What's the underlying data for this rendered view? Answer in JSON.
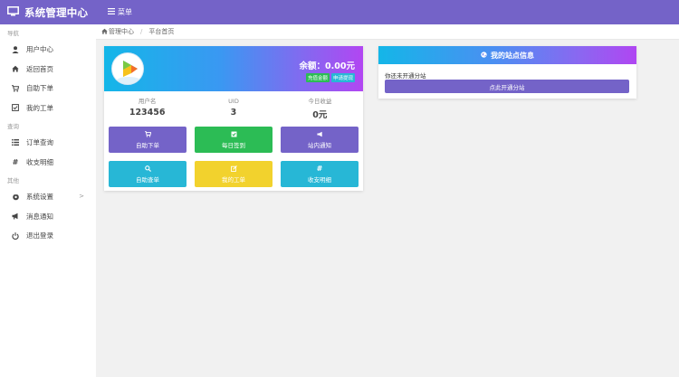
{
  "header": {
    "brand_title": "系统管理中心",
    "menu_label": "菜单"
  },
  "sidebar": {
    "sections": [
      {
        "title": "导航",
        "items": [
          {
            "label": "用户中心",
            "icon": "user-icon"
          },
          {
            "label": "返回首页",
            "icon": "home-icon"
          },
          {
            "label": "自助下单",
            "icon": "cart-icon"
          },
          {
            "label": "我的工单",
            "icon": "checkbox-icon"
          }
        ]
      },
      {
        "title": "查询",
        "items": [
          {
            "label": "订单查询",
            "icon": "list-icon"
          },
          {
            "label": "收支明细",
            "icon": "hash-icon"
          }
        ]
      },
      {
        "title": "其他",
        "items": [
          {
            "label": "系统设置",
            "icon": "settings-icon",
            "arrow": ">"
          },
          {
            "label": "消息通知",
            "icon": "bullhorn-icon"
          },
          {
            "label": "退出登录",
            "icon": "power-icon"
          }
        ]
      }
    ]
  },
  "breadcrumb": {
    "home": "管理中心",
    "current": "平台首页"
  },
  "user_card": {
    "balance": "余额：0.00元",
    "badge_recharge": "充值金额",
    "badge_withdraw": "申请提现",
    "stats": [
      {
        "label": "用户名",
        "value": "123456"
      },
      {
        "label": "UID",
        "value": "3"
      },
      {
        "label": "今日收益",
        "value": "0元"
      }
    ],
    "buttons": [
      {
        "label": "自助下单",
        "icon": "cart-icon",
        "color": "#7463c8"
      },
      {
        "label": "每日签到",
        "icon": "checkbox-icon",
        "color": "#2cbc55"
      },
      {
        "label": "站内通知",
        "icon": "bullhorn-icon",
        "color": "#7463c8"
      },
      {
        "label": "自助查单",
        "icon": "search-icon",
        "color": "#27b7d6"
      },
      {
        "label": "我的工单",
        "icon": "edit-icon",
        "color": "#f2d22d"
      },
      {
        "label": "收支明细",
        "icon": "hash-icon",
        "color": "#27b7d6"
      }
    ]
  },
  "site_card": {
    "title": "我的站点信息",
    "message": "你还未开通分站",
    "button": "点此开通分站"
  },
  "colors": {
    "accent": "#7463c8",
    "green": "#2cbc55",
    "cyan": "#27b7d6",
    "yellow": "#f2d22d"
  }
}
